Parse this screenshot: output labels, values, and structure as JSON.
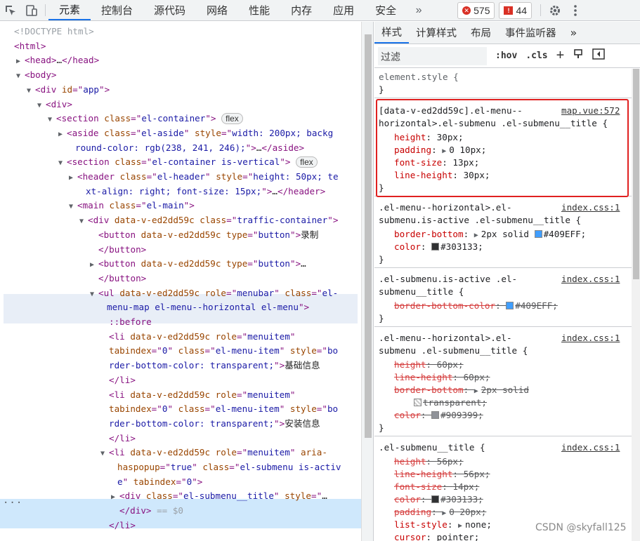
{
  "toolbar": {
    "tabs": [
      "元素",
      "控制台",
      "源代码",
      "网络",
      "性能",
      "内存",
      "应用",
      "安全"
    ],
    "more": "»",
    "errors": "575",
    "warnings": "44"
  },
  "dom_lines": [
    {
      "ind": 0,
      "parts": [
        [
          "cm",
          "<!DOCTYPE html>"
        ]
      ]
    },
    {
      "ind": 0,
      "parts": [
        [
          "tag",
          "<html>"
        ]
      ]
    },
    {
      "ind": 1,
      "arrow": "right",
      "parts": [
        [
          "tag",
          "<head>"
        ],
        [
          "txt",
          "…"
        ],
        [
          "tag",
          "</head>"
        ]
      ]
    },
    {
      "ind": 1,
      "arrow": "down",
      "parts": [
        [
          "tag",
          "<body>"
        ]
      ]
    },
    {
      "ind": 2,
      "arrow": "down",
      "parts": [
        [
          "tag",
          "<div "
        ],
        [
          "attr",
          "id"
        ],
        [
          "tag",
          "=\""
        ],
        [
          "val",
          "app"
        ],
        [
          "tag",
          "\">"
        ]
      ]
    },
    {
      "ind": 3,
      "arrow": "down",
      "parts": [
        [
          "tag",
          "<div>"
        ]
      ]
    },
    {
      "ind": 4,
      "arrow": "down",
      "parts": [
        [
          "tag",
          "<section "
        ],
        [
          "attr",
          "class"
        ],
        [
          "tag",
          "=\""
        ],
        [
          "val",
          "el-container"
        ],
        [
          "tag",
          "\">"
        ]
      ],
      "pill": "flex"
    },
    {
      "ind": 5,
      "arrow": "right",
      "parts": [
        [
          "tag",
          "<aside "
        ],
        [
          "attr",
          "class"
        ],
        [
          "tag",
          "=\""
        ],
        [
          "val",
          "el-aside"
        ],
        [
          "tag",
          "\" "
        ],
        [
          "attr",
          "style"
        ],
        [
          "tag",
          "=\""
        ],
        [
          "val",
          "width: 200px; backg"
        ]
      ]
    },
    {
      "ind": 5,
      "cont": true,
      "parts": [
        [
          "val",
          "round-color: rgb(238, 241, 246);"
        ],
        [
          "tag",
          "\">"
        ],
        [
          "txt",
          "…"
        ],
        [
          "tag",
          "</aside>"
        ]
      ]
    },
    {
      "ind": 5,
      "arrow": "down",
      "parts": [
        [
          "tag",
          "<section "
        ],
        [
          "attr",
          "class"
        ],
        [
          "tag",
          "=\""
        ],
        [
          "val",
          "el-container is-vertical"
        ],
        [
          "tag",
          "\">"
        ]
      ],
      "pill": "flex"
    },
    {
      "ind": 6,
      "arrow": "right",
      "parts": [
        [
          "tag",
          "<header "
        ],
        [
          "attr",
          "class"
        ],
        [
          "tag",
          "=\""
        ],
        [
          "val",
          "el-header"
        ],
        [
          "tag",
          "\" "
        ],
        [
          "attr",
          "style"
        ],
        [
          "tag",
          "=\""
        ],
        [
          "val",
          "height: 50px; te"
        ]
      ]
    },
    {
      "ind": 6,
      "cont": true,
      "parts": [
        [
          "val",
          "xt-align: right; font-size: 15px;"
        ],
        [
          "tag",
          "\">"
        ],
        [
          "txt",
          "…"
        ],
        [
          "tag",
          "</header>"
        ]
      ]
    },
    {
      "ind": 6,
      "arrow": "down",
      "parts": [
        [
          "tag",
          "<main "
        ],
        [
          "attr",
          "class"
        ],
        [
          "tag",
          "=\""
        ],
        [
          "val",
          "el-main"
        ],
        [
          "tag",
          "\">"
        ]
      ]
    },
    {
      "ind": 7,
      "arrow": "down",
      "parts": [
        [
          "tag",
          "<div "
        ],
        [
          "attr",
          "data-v-ed2dd59c class"
        ],
        [
          "tag",
          "=\""
        ],
        [
          "val",
          "traffic-container"
        ],
        [
          "tag",
          "\">"
        ]
      ]
    },
    {
      "ind": 8,
      "parts": [
        [
          "tag",
          "<button "
        ],
        [
          "attr",
          "data-v-ed2dd59c type"
        ],
        [
          "tag",
          "=\""
        ],
        [
          "val",
          "button"
        ],
        [
          "tag",
          "\">"
        ],
        [
          "txt",
          "录制"
        ]
      ]
    },
    {
      "ind": 8,
      "parts": [
        [
          "tag",
          "</button>"
        ]
      ]
    },
    {
      "ind": 8,
      "arrow": "right",
      "parts": [
        [
          "tag",
          "<button "
        ],
        [
          "attr",
          "data-v-ed2dd59c type"
        ],
        [
          "tag",
          "=\""
        ],
        [
          "val",
          "button"
        ],
        [
          "tag",
          "\">"
        ],
        [
          "txt",
          "…"
        ]
      ]
    },
    {
      "ind": 8,
      "parts": [
        [
          "tag",
          "</button>"
        ]
      ]
    },
    {
      "ind": 8,
      "arrow": "down",
      "soft": true,
      "parts": [
        [
          "tag",
          "<ul "
        ],
        [
          "attr",
          "data-v-ed2dd59c role"
        ],
        [
          "tag",
          "=\""
        ],
        [
          "val",
          "menubar"
        ],
        [
          "tag",
          "\" "
        ],
        [
          "attr",
          "class"
        ],
        [
          "tag",
          "=\""
        ],
        [
          "val",
          "el-"
        ]
      ]
    },
    {
      "ind": 8,
      "cont": true,
      "soft": true,
      "parts": [
        [
          "val",
          "menu-map el-menu--horizontal el-menu"
        ],
        [
          "tag",
          "\">"
        ]
      ]
    },
    {
      "ind": 9,
      "parts": [
        [
          "tag",
          "::before"
        ]
      ]
    },
    {
      "ind": 9,
      "parts": [
        [
          "tag",
          "<li "
        ],
        [
          "attr",
          "data-v-ed2dd59c role"
        ],
        [
          "tag",
          "=\""
        ],
        [
          "val",
          "menuitem"
        ],
        [
          "tag",
          "\""
        ]
      ]
    },
    {
      "ind": 9,
      "parts": [
        [
          "attr",
          "tabindex"
        ],
        [
          "tag",
          "=\""
        ],
        [
          "val",
          "0"
        ],
        [
          "tag",
          "\" "
        ],
        [
          "attr",
          "class"
        ],
        [
          "tag",
          "=\""
        ],
        [
          "val",
          "el-menu-item"
        ],
        [
          "tag",
          "\" "
        ],
        [
          "attr",
          "style"
        ],
        [
          "tag",
          "=\""
        ],
        [
          "val",
          "bo"
        ]
      ]
    },
    {
      "ind": 9,
      "parts": [
        [
          "val",
          "rder-bottom-color: transparent;"
        ],
        [
          "tag",
          "\">"
        ],
        [
          "txt",
          "基础信息"
        ]
      ]
    },
    {
      "ind": 9,
      "parts": [
        [
          "tag",
          "</li>"
        ]
      ]
    },
    {
      "ind": 9,
      "parts": [
        [
          "tag",
          "<li "
        ],
        [
          "attr",
          "data-v-ed2dd59c role"
        ],
        [
          "tag",
          "=\""
        ],
        [
          "val",
          "menuitem"
        ],
        [
          "tag",
          "\""
        ]
      ]
    },
    {
      "ind": 9,
      "parts": [
        [
          "attr",
          "tabindex"
        ],
        [
          "tag",
          "=\""
        ],
        [
          "val",
          "0"
        ],
        [
          "tag",
          "\" "
        ],
        [
          "attr",
          "class"
        ],
        [
          "tag",
          "=\""
        ],
        [
          "val",
          "el-menu-item"
        ],
        [
          "tag",
          "\" "
        ],
        [
          "attr",
          "style"
        ],
        [
          "tag",
          "=\""
        ],
        [
          "val",
          "bo"
        ]
      ]
    },
    {
      "ind": 9,
      "parts": [
        [
          "val",
          "rder-bottom-color: transparent;"
        ],
        [
          "tag",
          "\">"
        ],
        [
          "txt",
          "安装信息"
        ]
      ]
    },
    {
      "ind": 9,
      "parts": [
        [
          "tag",
          "</li>"
        ]
      ]
    },
    {
      "ind": 9,
      "arrow": "down",
      "parts": [
        [
          "tag",
          "<li "
        ],
        [
          "attr",
          "data-v-ed2dd59c role"
        ],
        [
          "tag",
          "=\""
        ],
        [
          "val",
          "menuitem"
        ],
        [
          "tag",
          "\" "
        ],
        [
          "attr",
          "aria-"
        ]
      ]
    },
    {
      "ind": 9,
      "cont": true,
      "parts": [
        [
          "attr",
          "haspopup"
        ],
        [
          "tag",
          "=\""
        ],
        [
          "val",
          "true"
        ],
        [
          "tag",
          "\" "
        ],
        [
          "attr",
          "class"
        ],
        [
          "tag",
          "=\""
        ],
        [
          "val",
          "el-submenu is-activ"
        ]
      ]
    },
    {
      "ind": 9,
      "cont": true,
      "parts": [
        [
          "val",
          "e"
        ],
        [
          "tag",
          "\" "
        ],
        [
          "attr",
          "tabindex"
        ],
        [
          "tag",
          "=\""
        ],
        [
          "val",
          "0"
        ],
        [
          "tag",
          "\">"
        ]
      ]
    },
    {
      "ind": 10,
      "arrow": "right",
      "sel": true,
      "parts": [
        [
          "tag",
          "<div "
        ],
        [
          "attr",
          "class"
        ],
        [
          "tag",
          "=\""
        ],
        [
          "val",
          "el-submenu__title"
        ],
        [
          "tag",
          "\" "
        ],
        [
          "attr",
          "style"
        ],
        [
          "tag",
          "=\""
        ],
        [
          "txt",
          "…"
        ]
      ]
    },
    {
      "ind": 10,
      "sel": true,
      "parts": [
        [
          "tag",
          "</div>"
        ],
        [
          "cm",
          " == $0"
        ]
      ]
    },
    {
      "ind": 9,
      "parts": [
        [
          "tag",
          "</li>"
        ]
      ]
    }
  ],
  "styles": {
    "tabs": [
      "样式",
      "计算样式",
      "布局",
      "事件监听器"
    ],
    "more": "»",
    "filter_placeholder": "过滤",
    "hov": ":hov",
    "cls": ".cls",
    "plus": "+",
    "element_style": "element.style {",
    "close": "}",
    "rules": [
      {
        "sel": [
          "[data-v-ed2dd59c].el-menu--",
          "horizontal>.el-submenu .el-submenu__title {"
        ],
        "src": "map.vue:572",
        "props": [
          {
            "n": "height",
            "v": "30px;"
          },
          {
            "n": "padding",
            "v": "0 10px;",
            "expand": true
          },
          {
            "n": "font-size",
            "v": "13px;"
          },
          {
            "n": "line-height",
            "v": "30px;"
          }
        ]
      },
      {
        "sel": [
          ".el-menu--horizontal>.el-",
          "submenu.is-active .el-submenu__title {"
        ],
        "src": "index.css:1",
        "props": [
          {
            "n": "border-bottom",
            "v": "2px solid ",
            "expand": true,
            "color": "#409EFF",
            "after": "#409EFF;"
          },
          {
            "n": "color",
            "v": "",
            "color": "#303133",
            "after": "#303133;"
          }
        ]
      },
      {
        "sel": [
          ".el-submenu.is-active .el-",
          "submenu__title {"
        ],
        "src": "index.css:1",
        "props": [
          {
            "n": "border-bottom-color",
            "v": "",
            "color": "#409EFF",
            "after": "#409EFF;",
            "strike": true
          }
        ]
      },
      {
        "sel": [
          ".el-menu--horizontal>.el-",
          "submenu .el-submenu__title {"
        ],
        "src": "index.css:1",
        "props": [
          {
            "n": "height",
            "v": "60px;",
            "strike": true
          },
          {
            "n": "line-height",
            "v": "60px;",
            "strike": true
          },
          {
            "n": "border-bottom",
            "v": "2px solid",
            "expand": true,
            "strike": true
          },
          {
            "n": "",
            "v": "",
            "color": "transparent",
            "after": "transparent;",
            "strike": true,
            "indent": true
          },
          {
            "n": "color",
            "v": "",
            "color": "#909399",
            "after": "#909399;",
            "strike": true
          }
        ]
      },
      {
        "sel": [
          ".el-submenu__title {"
        ],
        "src": "index.css:1",
        "props": [
          {
            "n": "height",
            "v": "56px;",
            "strike": true
          },
          {
            "n": "line-height",
            "v": "56px;",
            "strike": true
          },
          {
            "n": "font-size",
            "v": "14px;",
            "strike": true
          },
          {
            "n": "color",
            "v": "",
            "color": "#303133",
            "after": "#303133;",
            "strike": true
          },
          {
            "n": "padding",
            "v": "0 20px;",
            "expand": true,
            "strike": true
          },
          {
            "n": "list-style",
            "v": "none;",
            "expand": true
          },
          {
            "n": "cursor",
            "v": "pointer;"
          }
        ]
      }
    ]
  },
  "watermark": "CSDN @skyfall125"
}
